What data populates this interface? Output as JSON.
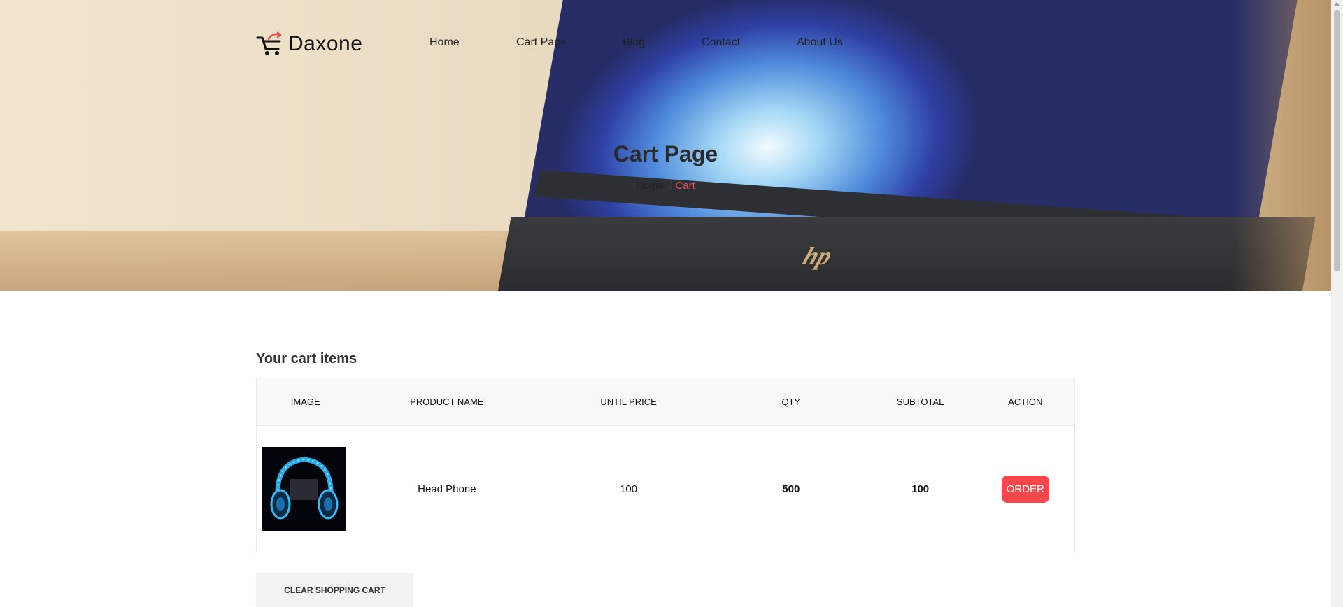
{
  "brand": {
    "name": "Daxone"
  },
  "nav": {
    "items": [
      {
        "label": "Home"
      },
      {
        "label": "Cart Page"
      },
      {
        "label": "Blog"
      },
      {
        "label": "Contact"
      },
      {
        "label": "About Us"
      }
    ]
  },
  "hero": {
    "title": "Cart Page",
    "breadcrumb": {
      "home": "Home",
      "separator": "/",
      "current": "Cart"
    }
  },
  "cart": {
    "heading": "Your cart items",
    "columns": [
      "IMAGE",
      "PRODUCT NAME",
      "UNTIL PRICE",
      "QTY",
      "SUBTOTAL",
      "ACTION"
    ],
    "rows": [
      {
        "image_icon": "headphone-product-image",
        "name": "Head Phone",
        "unit_price": "100",
        "qty": "500",
        "subtotal": "100",
        "action_label": "ORDER"
      }
    ],
    "clear_label": "CLEAR SHOPPING CART"
  },
  "colors": {
    "accent": "#f5474c",
    "breadcrumb_active": "#e84c4c",
    "table_header_bg": "#f9f9f9",
    "clear_button_bg": "#f2f2f2"
  }
}
